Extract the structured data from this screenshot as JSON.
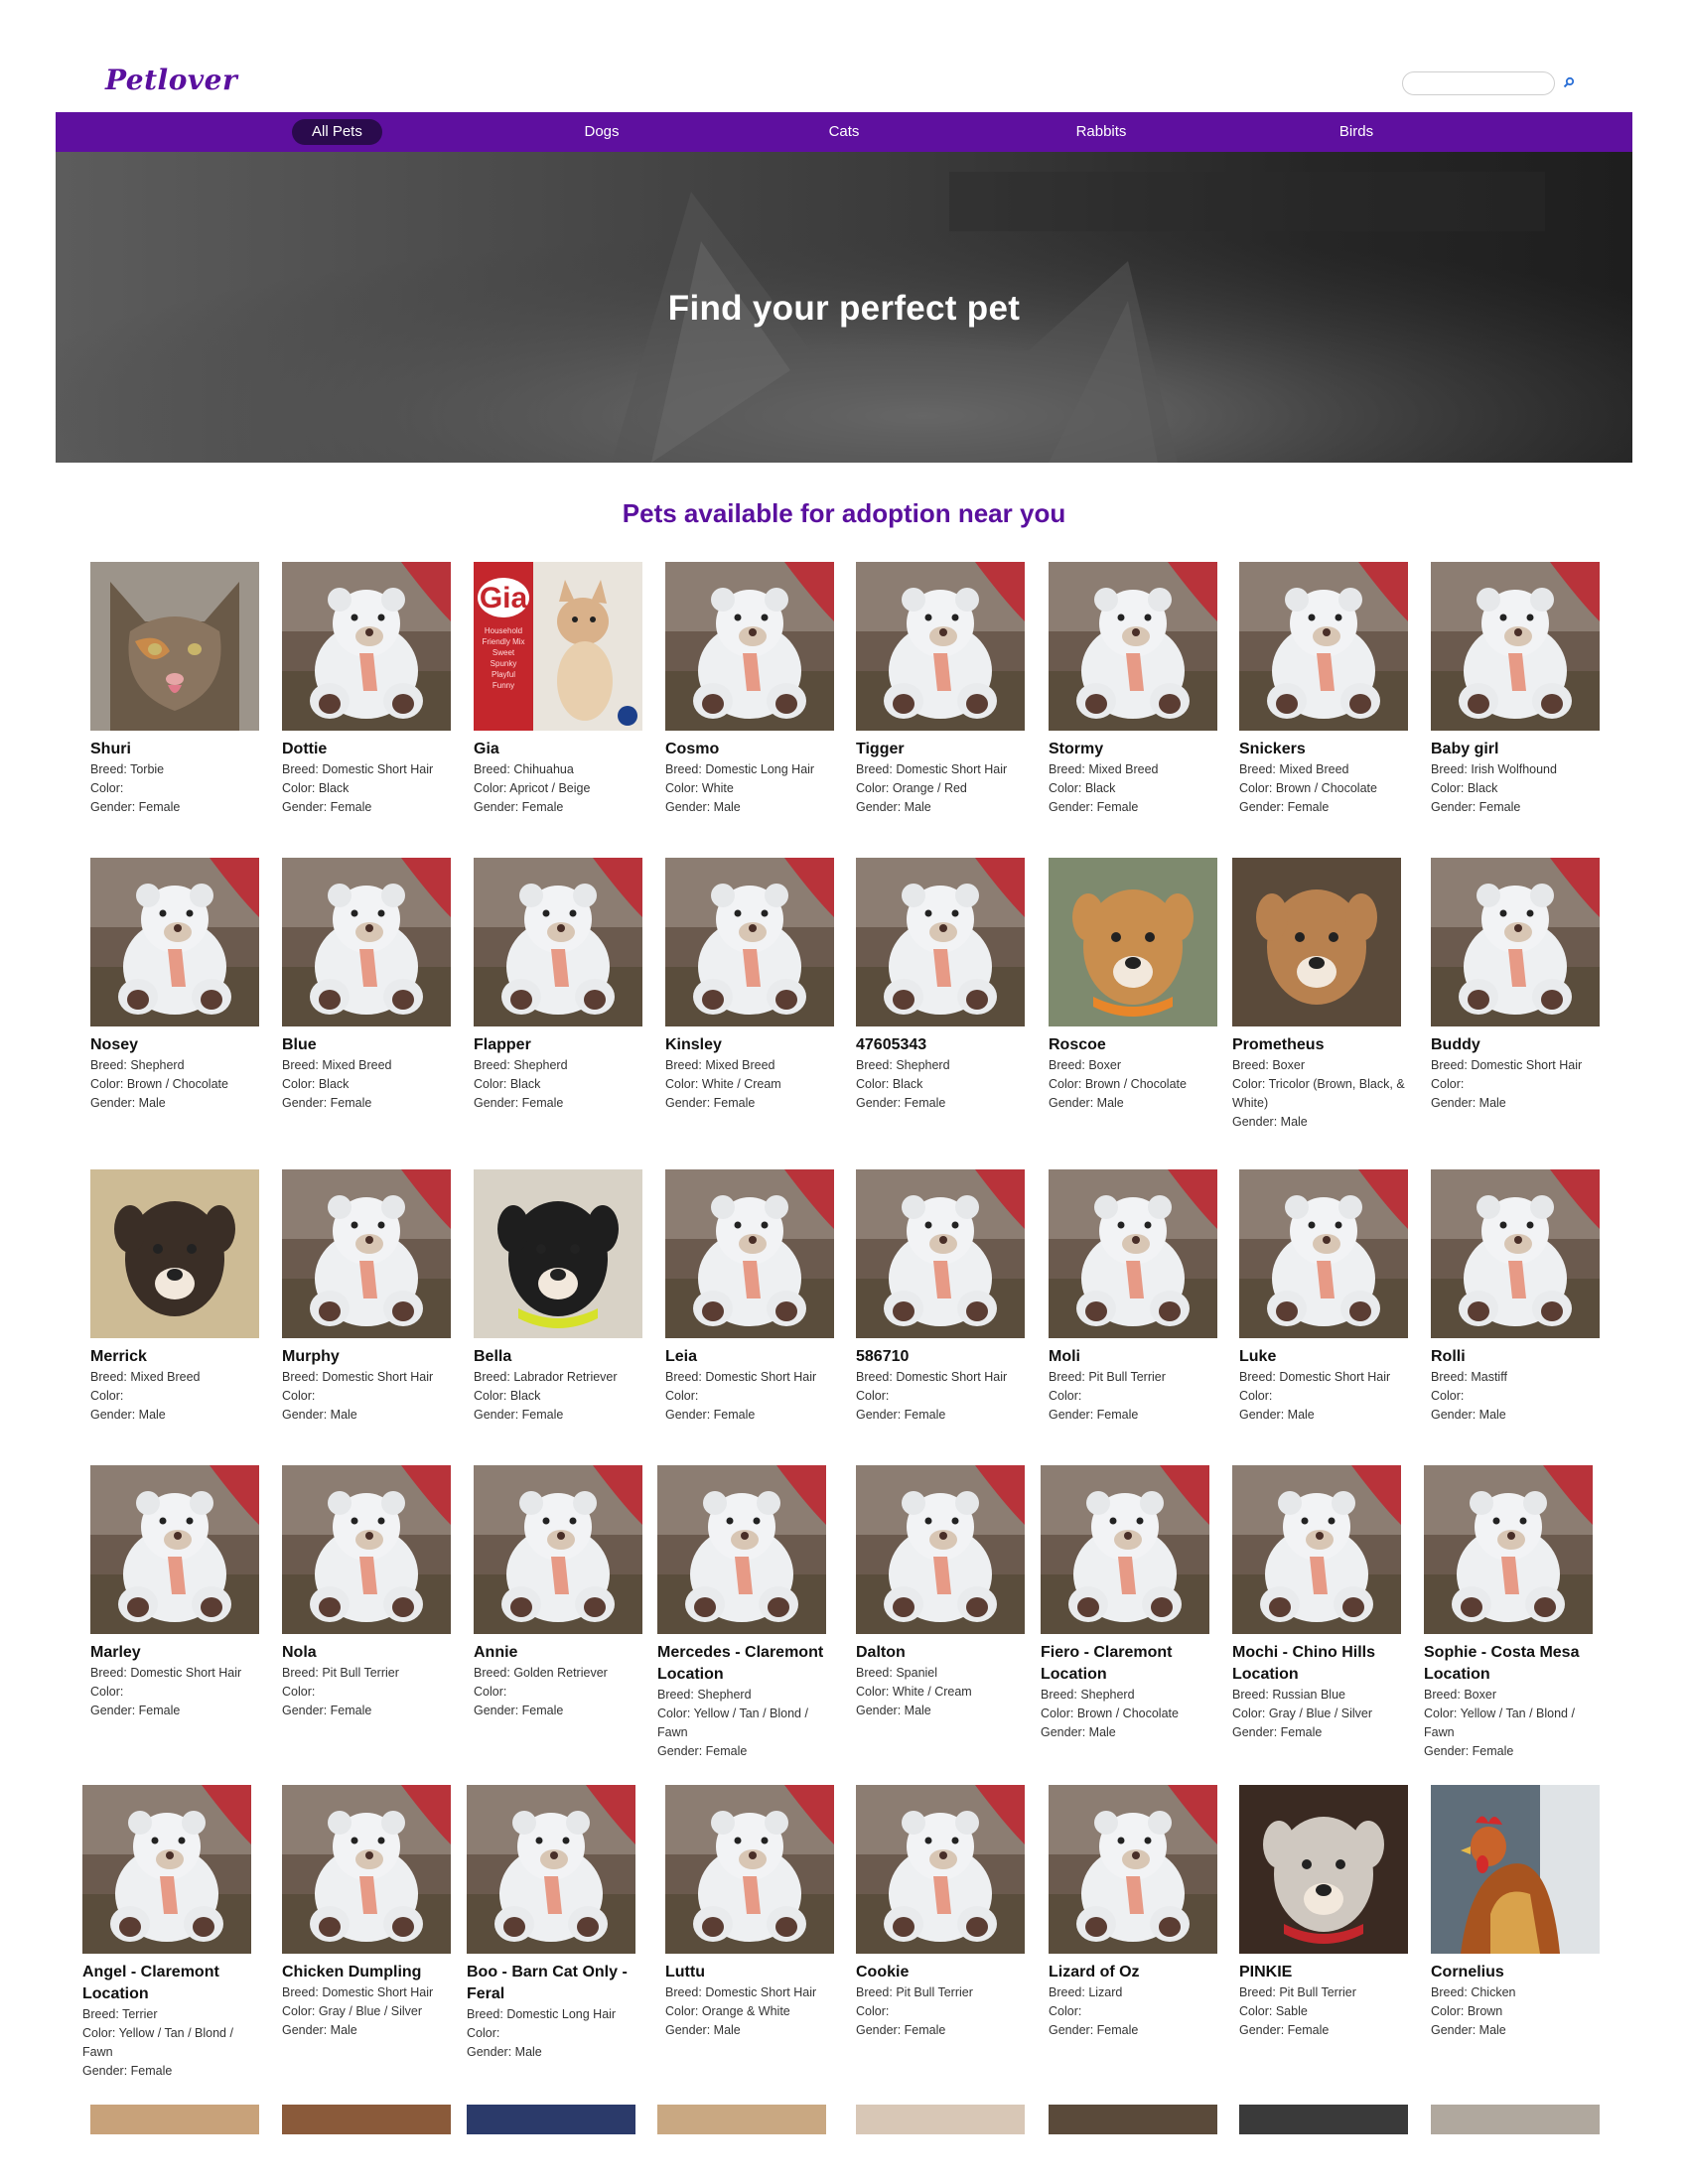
{
  "header": {
    "logo": "Petlover",
    "search_placeholder": ""
  },
  "nav": {
    "items": [
      {
        "label": "All Pets",
        "active": true
      },
      {
        "label": "Dogs",
        "active": false
      },
      {
        "label": "Cats",
        "active": false
      },
      {
        "label": "Rabbits",
        "active": false
      },
      {
        "label": "Birds",
        "active": false
      }
    ]
  },
  "hero": {
    "title": "Find your perfect pet"
  },
  "section": {
    "title": "Pets available for adoption near you"
  },
  "labels": {
    "breed": "Breed:",
    "color": "Color:",
    "gender": "Gender:"
  },
  "pets": [
    {
      "name": "Shuri",
      "breed": "Torbie",
      "color": "",
      "gender": "Female",
      "photo": "cat"
    },
    {
      "name": "Dottie",
      "breed": "Domestic Short Hair",
      "color": "Black",
      "gender": "Female",
      "photo": "bear"
    },
    {
      "name": "Gia",
      "breed": "Chihuahua",
      "color": "Apricot / Beige",
      "gender": "Female",
      "photo": "gia"
    },
    {
      "name": "Cosmo",
      "breed": "Domestic Long Hair",
      "color": "White",
      "gender": "Male",
      "photo": "bear"
    },
    {
      "name": "Tigger",
      "breed": "Domestic Short Hair",
      "color": "Orange / Red",
      "gender": "Male",
      "photo": "bear"
    },
    {
      "name": "Stormy",
      "breed": "Mixed Breed",
      "color": "Black",
      "gender": "Female",
      "photo": "bear"
    },
    {
      "name": "Snickers",
      "breed": "Mixed Breed",
      "color": "Brown / Chocolate",
      "gender": "Female",
      "photo": "bear"
    },
    {
      "name": "Baby girl",
      "breed": "Irish Wolfhound",
      "color": "Black",
      "gender": "Female",
      "photo": "bear"
    },
    {
      "name": "Nosey",
      "breed": "Shepherd",
      "color": "Brown / Chocolate",
      "gender": "Male",
      "photo": "bear"
    },
    {
      "name": "Blue",
      "breed": "Mixed Breed",
      "color": "Black",
      "gender": "Female",
      "photo": "bear"
    },
    {
      "name": "Flapper",
      "breed": "Shepherd",
      "color": "Black",
      "gender": "Female",
      "photo": "bear"
    },
    {
      "name": "Kinsley",
      "breed": "Mixed Breed",
      "color": "White / Cream",
      "gender": "Female",
      "photo": "bear"
    },
    {
      "name": "47605343",
      "breed": "Shepherd",
      "color": "Black",
      "gender": "Female",
      "photo": "bear"
    },
    {
      "name": "Roscoe",
      "breed": "Boxer",
      "color": "Brown / Chocolate",
      "gender": "Male",
      "photo": "dog1"
    },
    {
      "name": "Prometheus",
      "breed": "Boxer",
      "color": "Tricolor (Brown, Black, & White)",
      "gender": "Male",
      "photo": "dog2"
    },
    {
      "name": "Buddy",
      "breed": "Domestic Short Hair",
      "color": "",
      "gender": "Male",
      "photo": "bear"
    },
    {
      "name": "Merrick",
      "breed": "Mixed Breed",
      "color": "",
      "gender": "Male",
      "photo": "dog3"
    },
    {
      "name": "Murphy",
      "breed": "Domestic Short Hair",
      "color": "",
      "gender": "Male",
      "photo": "bear"
    },
    {
      "name": "Bella",
      "breed": "Labrador Retriever",
      "color": "Black",
      "gender": "Female",
      "photo": "dog4"
    },
    {
      "name": "Leia",
      "breed": "Domestic Short Hair",
      "color": "",
      "gender": "Female",
      "photo": "bear"
    },
    {
      "name": "586710",
      "breed": "Domestic Short Hair",
      "color": "",
      "gender": "Female",
      "photo": "bear"
    },
    {
      "name": "Moli",
      "breed": "Pit Bull Terrier",
      "color": "",
      "gender": "Female",
      "photo": "bear"
    },
    {
      "name": "Luke",
      "breed": "Domestic Short Hair",
      "color": "",
      "gender": "Male",
      "photo": "bear"
    },
    {
      "name": "Rolli",
      "breed": "Mastiff",
      "color": "",
      "gender": "Male",
      "photo": "bear"
    },
    {
      "name": "Marley",
      "breed": "Domestic Short Hair",
      "color": "",
      "gender": "Female",
      "photo": "bear"
    },
    {
      "name": "Nola",
      "breed": "Pit Bull Terrier",
      "color": "",
      "gender": "Female",
      "photo": "bear"
    },
    {
      "name": "Annie",
      "breed": "Golden Retriever",
      "color": "",
      "gender": "Female",
      "photo": "bear"
    },
    {
      "name": "Mercedes - Claremont Location",
      "breed": "Shepherd",
      "color": "Yellow / Tan / Blond / Fawn",
      "gender": "Female",
      "photo": "bear"
    },
    {
      "name": "Dalton",
      "breed": "Spaniel",
      "color": "White / Cream",
      "gender": "Male",
      "photo": "bear"
    },
    {
      "name": "Fiero - Claremont Location",
      "breed": "Shepherd",
      "color": "Brown / Chocolate",
      "gender": "Male",
      "photo": "bear"
    },
    {
      "name": "Mochi - Chino Hills Location",
      "breed": "Russian Blue",
      "color": "Gray / Blue / Silver",
      "gender": "Female",
      "photo": "bear"
    },
    {
      "name": "Sophie - Costa Mesa Location",
      "breed": "Boxer",
      "color": "Yellow / Tan / Blond / Fawn",
      "gender": "Female",
      "photo": "bear"
    },
    {
      "name": "Angel - Claremont Location",
      "breed": "Terrier",
      "color": "Yellow / Tan / Blond / Fawn",
      "gender": "Female",
      "photo": "bear"
    },
    {
      "name": "Chicken Dumpling",
      "breed": "Domestic Short Hair",
      "color": "Gray / Blue / Silver",
      "gender": "Male",
      "photo": "bear"
    },
    {
      "name": "Boo - Barn Cat Only - Feral",
      "breed": "Domestic Long Hair",
      "color": "",
      "gender": "Male",
      "photo": "bear"
    },
    {
      "name": "Luttu",
      "breed": "Domestic Short Hair",
      "color": "Orange & White",
      "gender": "Male",
      "photo": "bear"
    },
    {
      "name": "Cookie",
      "breed": "Pit Bull Terrier",
      "color": "",
      "gender": "Female",
      "photo": "bear"
    },
    {
      "name": "Lizard of Oz",
      "breed": "Lizard",
      "color": "",
      "gender": "Female",
      "photo": "bear"
    },
    {
      "name": "PINKIE",
      "breed": "Pit Bull Terrier",
      "color": "Sable",
      "gender": "Female",
      "photo": "dog5"
    },
    {
      "name": "Cornelius",
      "breed": "Chicken",
      "color": "Brown",
      "gender": "Male",
      "photo": "rooster"
    }
  ],
  "gia_card": {
    "title": "Gia",
    "lines": [
      "Household",
      "Friendly Mix",
      "Sweet",
      "Spunky",
      "Playful",
      "Funny"
    ]
  },
  "colors": {
    "brand": "#5e0f9f",
    "nav_active": "#2a0a4d",
    "title": "#5a0f9e"
  }
}
